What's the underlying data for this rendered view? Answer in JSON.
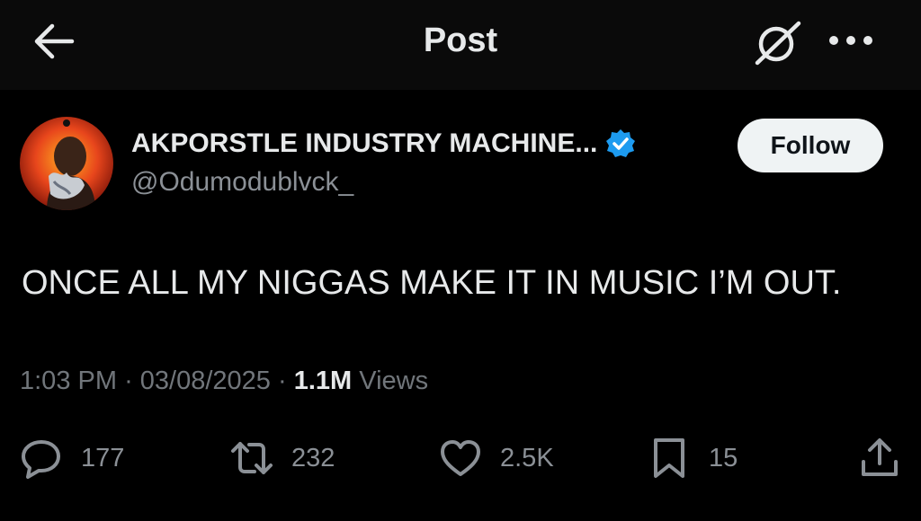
{
  "header": {
    "title": "Post",
    "back_icon": "arrow-left-icon",
    "grok_icon": "grok-icon",
    "more_icon": "more-horizontal-icon"
  },
  "author": {
    "display_name": "AKPORSTLE INDUSTRY MACHINE...",
    "handle": "@Odumodublvck_",
    "verified": true,
    "verified_color": "#1d9bf0",
    "follow_label": "Follow"
  },
  "post": {
    "text": "ONCE ALL MY NIGGAS MAKE IT IN MUSIC I’M OUT.",
    "time": "1:03 PM",
    "date": "03/08/2025",
    "views_count": "1.1M",
    "views_label": "Views"
  },
  "actions": {
    "replies": "177",
    "reposts": "232",
    "likes": "2.5K",
    "bookmarks": "15",
    "reply_icon": "reply-bubble-icon",
    "repost_icon": "repost-icon",
    "like_icon": "heart-icon",
    "bookmark_icon": "bookmark-icon",
    "share_icon": "share-icon"
  },
  "colors": {
    "background": "#000000",
    "header_background": "#0a0a0a",
    "text": "#e7e9ea",
    "muted": "#71767b",
    "follow_bg": "#eff3f4"
  }
}
